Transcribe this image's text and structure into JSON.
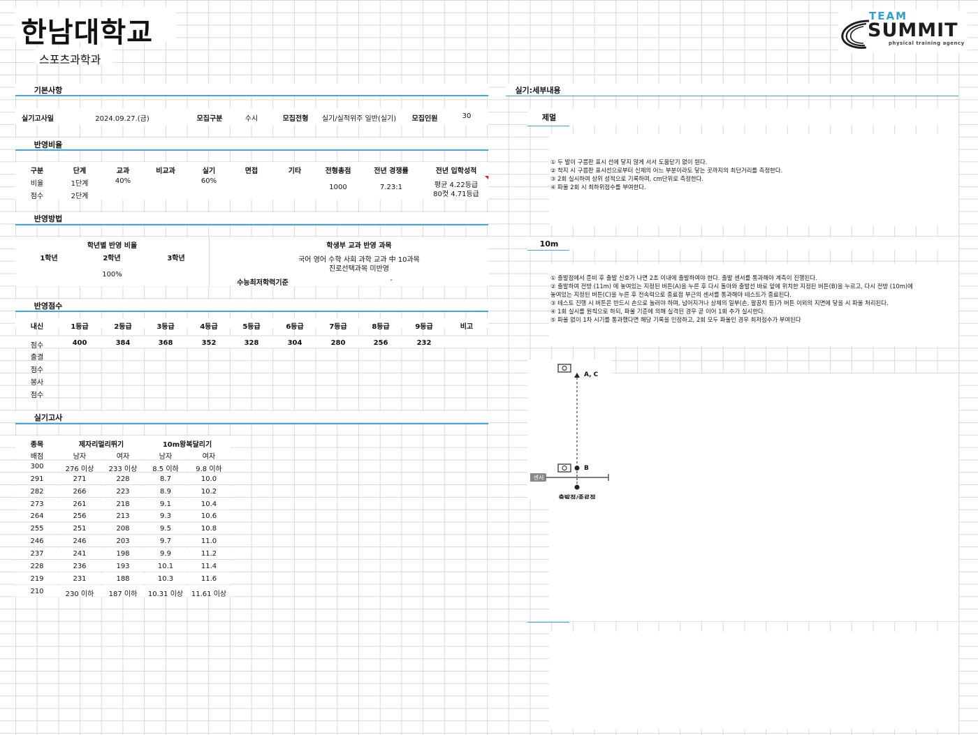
{
  "header": {
    "university": "한남대학교",
    "department": "스포츠과학과",
    "logo": {
      "team": "TEAM",
      "summit": "SUMMIT",
      "tagline": "physical training agency"
    }
  },
  "basic": {
    "title": "기본사항",
    "exam_date_label": "실기고사일",
    "exam_date": "2024.09.27.(금)",
    "type_label": "모집구분",
    "type": "수시",
    "track_label": "모집전형",
    "track": "실기/실적위주 일반(실기)",
    "quota_label": "모집인원",
    "quota": "30"
  },
  "ratio": {
    "title": "반영비율",
    "headers": [
      "구분",
      "단계",
      "교과",
      "비교과",
      "실기",
      "면접",
      "기타",
      "전형총점",
      "전년 경쟁률",
      "전년 입학성적"
    ],
    "row1": {
      "label": "비율",
      "stage": "1단계",
      "subject": "40%",
      "practical": "60%"
    },
    "row2": {
      "label": "점수",
      "stage": "2단계"
    },
    "total": "1000",
    "competition": "7.23:1",
    "grade_avg": "평균 4.22등급",
    "grade_cut": "80컷 4.71등급"
  },
  "method": {
    "title": "반영방법",
    "year_ratio_title": "학년별 반영 비율",
    "years": [
      "1학년",
      "2학년",
      "3학년"
    ],
    "year_value": "100%",
    "subjects_title": "학생부 교과 반영 과목",
    "subjects_line1": "국어 영어 수학 사회 과학 교과 中 10과목",
    "subjects_line2": "진로선택과목 미반영",
    "csat_label": "수능최저학력기준",
    "csat_value": "-"
  },
  "score": {
    "title": "반영점수",
    "headers": [
      "내신",
      "1등급",
      "2등급",
      "3등급",
      "4등급",
      "5등급",
      "6등급",
      "7등급",
      "8등급",
      "9등급",
      "비고"
    ],
    "score_label": "점수",
    "values": [
      "400",
      "384",
      "368",
      "352",
      "328",
      "304",
      "280",
      "256",
      "232"
    ],
    "extra_labels": [
      "출결",
      "점수",
      "봉사",
      "점수"
    ]
  },
  "practical": {
    "title": "실기고사",
    "col_item": "종목",
    "event1": "제자리멀리뛰기",
    "event2": "10m왕복달리기",
    "points_label": "배점",
    "male": "남자",
    "female": "여자",
    "rows": [
      [
        "300",
        "276 이상",
        "233 이상",
        "8.5 이하",
        "9.8 이하"
      ],
      [
        "291",
        "271",
        "228",
        "8.7",
        "10.0"
      ],
      [
        "282",
        "266",
        "223",
        "8.9",
        "10.2"
      ],
      [
        "273",
        "261",
        "218",
        "9.1",
        "10.4"
      ],
      [
        "264",
        "256",
        "213",
        "9.3",
        "10.6"
      ],
      [
        "255",
        "251",
        "208",
        "9.5",
        "10.8"
      ],
      [
        "246",
        "246",
        "203",
        "9.7",
        "11.0"
      ],
      [
        "237",
        "241",
        "198",
        "9.9",
        "11.2"
      ],
      [
        "228",
        "236",
        "193",
        "10.1",
        "11.4"
      ],
      [
        "219",
        "231",
        "188",
        "10.3",
        "11.6"
      ],
      [
        "210",
        "230 이하",
        "187 이하",
        "10.31 이상",
        "11.61 이상"
      ]
    ]
  },
  "details": {
    "title": "실기:세부내용",
    "jump_title": "제멀",
    "jump_lines": [
      "① 두 발이 구름판 표시 선에 닿지 않게 서서 도움닫기 없이 뛴다.",
      "② 착지 시 구름판 표시선으로부터 신체의 어느 부분이라도 닿는 곳까지의 최단거리를 측정한다.",
      "③ 2회 실시하여 상위 성적으로 기록하며, cm단위로 측정한다.",
      "④ 파울 2회 시 최하위점수를 부여한다."
    ],
    "run_title": "10m",
    "run_lines": [
      "① 출발점에서 준비 후 출발 신호가 나면 2초 이내에 출발하여야 한다. 출발 센서를 통과해야 계측이 진행된다.",
      "② 출발하여 전방 (11m) 에 놓여있는 지정된 버튼(A)을 누른 후 다시 돌아와 출발선 바로 앞에 위치한 지정된 버튼(B)을 누르고, 다시 전방 (10m)에",
      "놓여있는 지정된 버튼(C)을 누른 후 전속력으로 종료점 부근의 센서를 통과해야 테스트가 종료된다.",
      "③ 테스트 진행 시 버튼은 반드시 손으로 눌러야 하며, 넘어지거나 상체의 일부(손, 팔꿈치 등)가 버튼 이외의 지면에 닿을 시 파울 처리된다.",
      "④ 1회 실시를 원칙으로 하되, 파울 기준에 의해 실격된 경우 곧 이어 1회 추가 실시한다.",
      "⑤ 파울 없이 1차 시기를 통과했다면 해당 기록을 인정하고, 2회 모두 파울인 경우 최저점수가 부여된다"
    ],
    "diagram": {
      "label_ac": "A, C",
      "label_b": "B",
      "sensor": "센서",
      "start_end": "출발점/종료점"
    }
  }
}
